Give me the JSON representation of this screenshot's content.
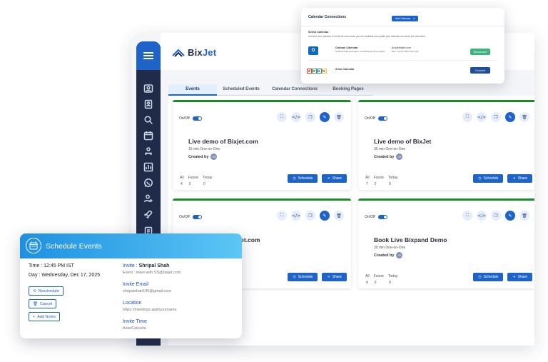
{
  "app": {
    "logo_brand_a": "Bix",
    "logo_brand_b": "Jet",
    "tabs": [
      "Events",
      "Scheduled Events",
      "Calendar Connections",
      "Booking Pages"
    ],
    "active_tab": "Events",
    "sidebar_icons": [
      "contacts-icon",
      "address-book-icon",
      "search-icon",
      "calendar-icon",
      "user-group-icon",
      "report-icon",
      "whatsapp-icon",
      "user-settings-icon",
      "rocket-icon",
      "document-icon"
    ]
  },
  "cards": [
    {
      "toggle_label": "On/Off",
      "title": "Live demo of Bixjet.com",
      "sub": "15 min One-on-One",
      "created_by": "Created by",
      "avatar": "SS",
      "stats": [
        {
          "label": "All",
          "value": "4"
        },
        {
          "label": "Future",
          "value": "0"
        },
        {
          "label": "Today",
          "value": "0"
        }
      ],
      "schedule_label": "Schedule",
      "share_label": "Share"
    },
    {
      "toggle_label": "On/Off",
      "title": "Live demo of BixJet",
      "sub": "30 min One-on-One",
      "created_by": "Created by",
      "avatar": "SS",
      "stats": [
        {
          "label": "All",
          "value": "7"
        },
        {
          "label": "Future",
          "value": "0"
        },
        {
          "label": "Today",
          "value": "0"
        }
      ],
      "schedule_label": "Schedule",
      "share_label": "Share"
    },
    {
      "toggle_label": "On/Off",
      "title": "xjet.com",
      "sub": "",
      "created_by": "",
      "avatar": "",
      "stats": [],
      "schedule_label": "Schedule",
      "share_label": "Share"
    },
    {
      "toggle_label": "On/Off",
      "title": "Book Live Bixpand Demo",
      "sub": "30 min One-on-One",
      "created_by": "Created by",
      "avatar": "SS",
      "stats": [
        {
          "label": "All",
          "value": "4"
        },
        {
          "label": "Future",
          "value": "0"
        },
        {
          "label": "Today",
          "value": "0"
        }
      ],
      "schedule_label": "Schedule",
      "share_label": "Share"
    }
  ],
  "calendar": {
    "title": "Calendar Connections",
    "add_label": "Add Calendar",
    "select_label": "Select Calendar",
    "select_desc": "Connect your calendar to let BixJet know when you are available and update your calendar as events are scheduled.",
    "rows": [
      {
        "name": "Outlook Calendar",
        "detail": "Outlook 2019 and higher, and Windows Team higher",
        "account": "Aru@bixjet.com",
        "account_sub": "Mon, Jul 05, 2023 10:10 AM",
        "button": "Disconnect",
        "button_color": "#3fb37f",
        "logo_color": "#0f6cbd",
        "logo_text": "O"
      },
      {
        "name": "Zoho Calendar",
        "detail": "",
        "account": "",
        "account_sub": "",
        "button": "Connect",
        "button_color": "#1e4d9a",
        "logo_color": "#ffffff",
        "logo_text": "ZOHO"
      }
    ]
  },
  "schedule": {
    "title": "Schedule Events",
    "time": "Time : 12:45 PM IST",
    "day": "Day : Wednesday, Dec 17, 2025",
    "reschedule": "Reschedule",
    "cancel": "Cancel",
    "add_notes": "Add Notes",
    "invite_label": "Invite : ",
    "invite_name": "Shripal Shah",
    "invite_event": "Event : meet with SS@bixjet.com",
    "email_label": "Invite Email",
    "email_value": "shripalshah105@gmail.com",
    "location_label": "Location",
    "location_value": "https://meetings.app/yourname",
    "invite_time_label": "Invite Time",
    "invite_time_value": "Asia/Calcutta"
  },
  "colors": {
    "accent": "#1e64c8",
    "sidebar": "#1f2b49",
    "card_top": "#1f8a2a",
    "header_gradient_start": "#1e90e0",
    "header_gradient_end": "#5cc6f5"
  }
}
